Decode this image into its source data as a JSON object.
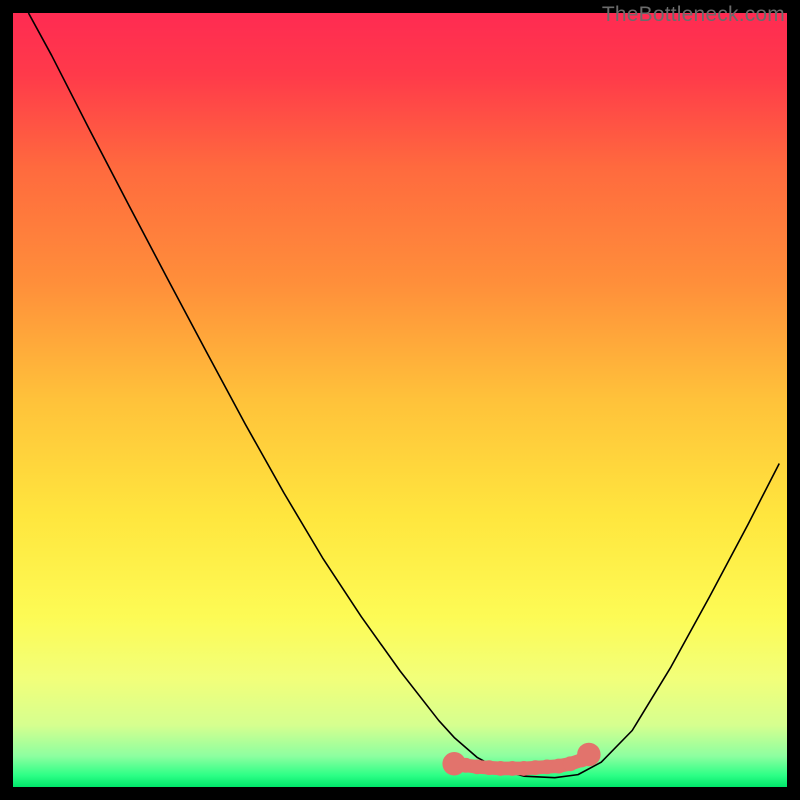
{
  "watermark": "TheBottleneck.com",
  "chart_data": {
    "type": "line",
    "title": "",
    "xlabel": "",
    "ylabel": "",
    "xlim": [
      0,
      100
    ],
    "ylim": [
      0,
      100
    ],
    "gradient_stops": [
      {
        "offset": 0.0,
        "color": "#ff2b52"
      },
      {
        "offset": 0.08,
        "color": "#ff3a4a"
      },
      {
        "offset": 0.2,
        "color": "#ff6a3e"
      },
      {
        "offset": 0.35,
        "color": "#ff8f3a"
      },
      {
        "offset": 0.5,
        "color": "#ffc23a"
      },
      {
        "offset": 0.65,
        "color": "#ffe63e"
      },
      {
        "offset": 0.78,
        "color": "#fdfb55"
      },
      {
        "offset": 0.86,
        "color": "#f2ff7a"
      },
      {
        "offset": 0.92,
        "color": "#d6ff8f"
      },
      {
        "offset": 0.96,
        "color": "#8dffa0"
      },
      {
        "offset": 0.985,
        "color": "#2dff86"
      },
      {
        "offset": 1.0,
        "color": "#00e66a"
      }
    ],
    "series": [
      {
        "name": "bottleneck-curve",
        "type": "line",
        "color": "#000000",
        "x": [
          2,
          5,
          10,
          15,
          20,
          25,
          30,
          35,
          40,
          45,
          50,
          55,
          57,
          60,
          63,
          66,
          70,
          73,
          76,
          80,
          85,
          90,
          95,
          99
        ],
        "y": [
          100,
          94.5,
          84.7,
          75.1,
          65.6,
          56.2,
          46.9,
          38.0,
          29.6,
          22.0,
          15.0,
          8.6,
          6.4,
          3.8,
          2.2,
          1.4,
          1.2,
          1.6,
          3.2,
          7.3,
          15.5,
          24.6,
          34.0,
          41.8
        ]
      },
      {
        "name": "optimal-band",
        "type": "marker-band",
        "color": "#e2736c",
        "x": [
          57,
          58.5,
          60,
          61.5,
          63,
          64.5,
          66,
          67.5,
          69,
          70.5,
          72,
          73.5,
          74.4
        ],
        "y": [
          3.0,
          2.8,
          2.6,
          2.5,
          2.4,
          2.4,
          2.4,
          2.5,
          2.6,
          2.7,
          3.0,
          3.5,
          4.2
        ],
        "marker_radius": 1.6,
        "end_caps": true
      }
    ]
  }
}
